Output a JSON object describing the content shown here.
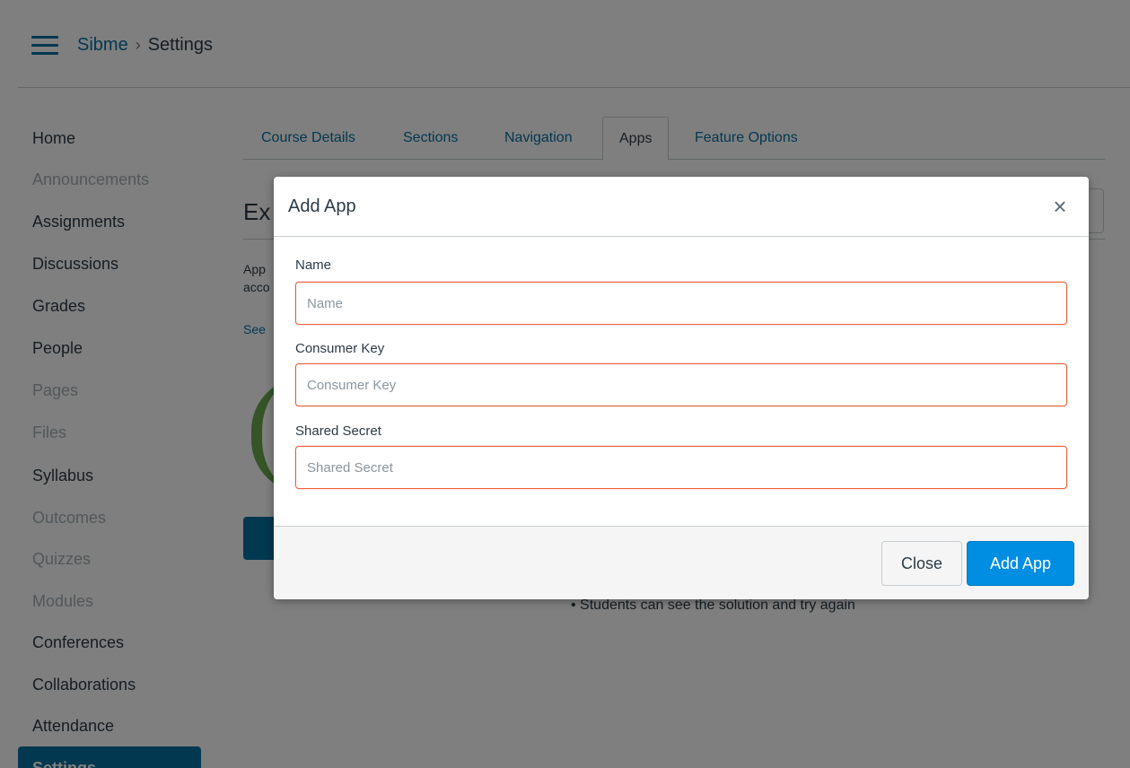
{
  "header": {
    "breadcrumb_root": "Sibme",
    "breadcrumb_separator": "›",
    "breadcrumb_current": "Settings"
  },
  "sidebar": {
    "items": [
      {
        "label": "Home",
        "enabled": true
      },
      {
        "label": "Announcements",
        "enabled": false
      },
      {
        "label": "Assignments",
        "enabled": true
      },
      {
        "label": "Discussions",
        "enabled": true
      },
      {
        "label": "Grades",
        "enabled": true
      },
      {
        "label": "People",
        "enabled": true
      },
      {
        "label": "Pages",
        "enabled": false
      },
      {
        "label": "Files",
        "enabled": false
      },
      {
        "label": "Syllabus",
        "enabled": true
      },
      {
        "label": "Outcomes",
        "enabled": false
      },
      {
        "label": "Quizzes",
        "enabled": false
      },
      {
        "label": "Modules",
        "enabled": false
      },
      {
        "label": "Conferences",
        "enabled": true
      },
      {
        "label": "Collaborations",
        "enabled": true
      },
      {
        "label": "Attendance",
        "enabled": true
      }
    ],
    "active_label": "Settings"
  },
  "tabs": [
    {
      "label": "Course Details"
    },
    {
      "label": "Sections"
    },
    {
      "label": "Navigation"
    },
    {
      "label": "Apps",
      "active": true
    },
    {
      "label": "Feature Options"
    }
  ],
  "background": {
    "title_fragment": "Ex",
    "line1_fragment": "App",
    "line2_fragment": "acco",
    "link_fragment": "See",
    "bullet_text": "• Students can see the solution and try again"
  },
  "modal": {
    "title": "Add App",
    "close_glyph": "×",
    "fields": {
      "name": {
        "label": "Name",
        "placeholder": "Name",
        "value": ""
      },
      "consumer_key": {
        "label": "Consumer Key",
        "placeholder": "Consumer Key",
        "value": ""
      },
      "shared_secret": {
        "label": "Shared Secret",
        "placeholder": "Shared Secret",
        "value": ""
      }
    },
    "buttons": {
      "close_label": "Close",
      "add_label": "Add App"
    }
  },
  "colors": {
    "link": "#0770a3",
    "primary_button": "#008ee2",
    "invalid_border": "#e66135",
    "disabled_text": "#a5afb5"
  }
}
